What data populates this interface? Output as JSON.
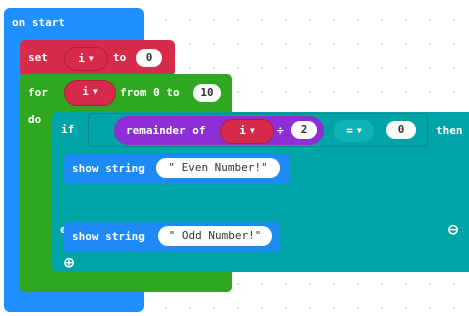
{
  "on_start": {
    "label": "on start"
  },
  "set_block": {
    "keyword": "set",
    "variable": "i",
    "to_label": "to",
    "value": "0"
  },
  "for_block": {
    "keyword": "for",
    "variable": "i",
    "from_label": "from 0 to",
    "end_value": "10",
    "do_label": "do"
  },
  "if_block": {
    "keyword": "if",
    "condition": {
      "function_label": "remainder of",
      "variable": "i",
      "operator": "÷",
      "divisor": "2",
      "compare_op": "=",
      "compare_value": "0"
    },
    "then_label": "then",
    "else_label": "else"
  },
  "show_even": {
    "label": "show string",
    "text": "\" Even Number!\""
  },
  "show_odd": {
    "label": "show string",
    "text": "\" Odd Number!\""
  },
  "icons": {
    "dropdown": "▼",
    "remove": "⊖",
    "add": "⊕"
  }
}
